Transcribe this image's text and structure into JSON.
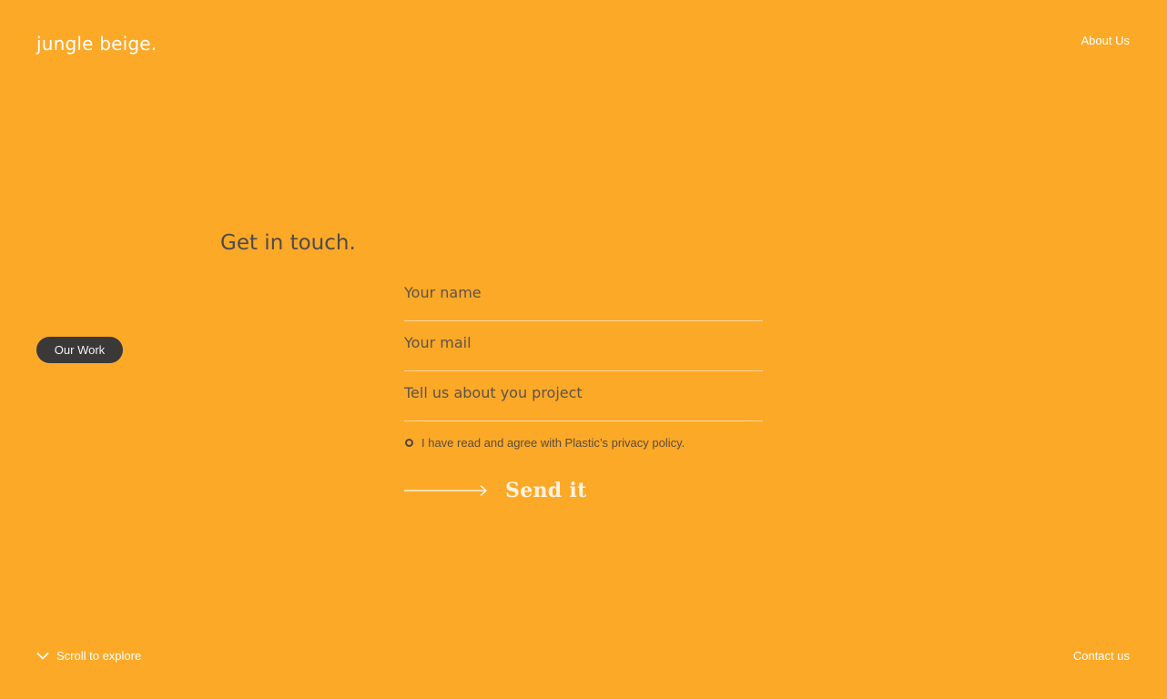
{
  "header": {
    "logo": "jungle beige.",
    "nav_about": "About Us"
  },
  "main": {
    "heading": "Get in touch.",
    "our_work": "Our Work",
    "form": {
      "name_placeholder": "Your name",
      "mail_placeholder": "Your mail",
      "project_placeholder": "Tell us about you project",
      "privacy_text": "I have read and agree with Plastic’s privacy policy.",
      "send_label": "Send it"
    }
  },
  "footer": {
    "scroll_label": "Scroll to explore",
    "contact_label": "Contact us"
  },
  "icons": {
    "arrow": "arrow-right-icon",
    "chevron": "chevron-down-icon",
    "radio": "radio-icon"
  },
  "colors": {
    "background": "#fca928",
    "dark_pill": "#3b3838",
    "heading_text": "#4f4a4a"
  }
}
